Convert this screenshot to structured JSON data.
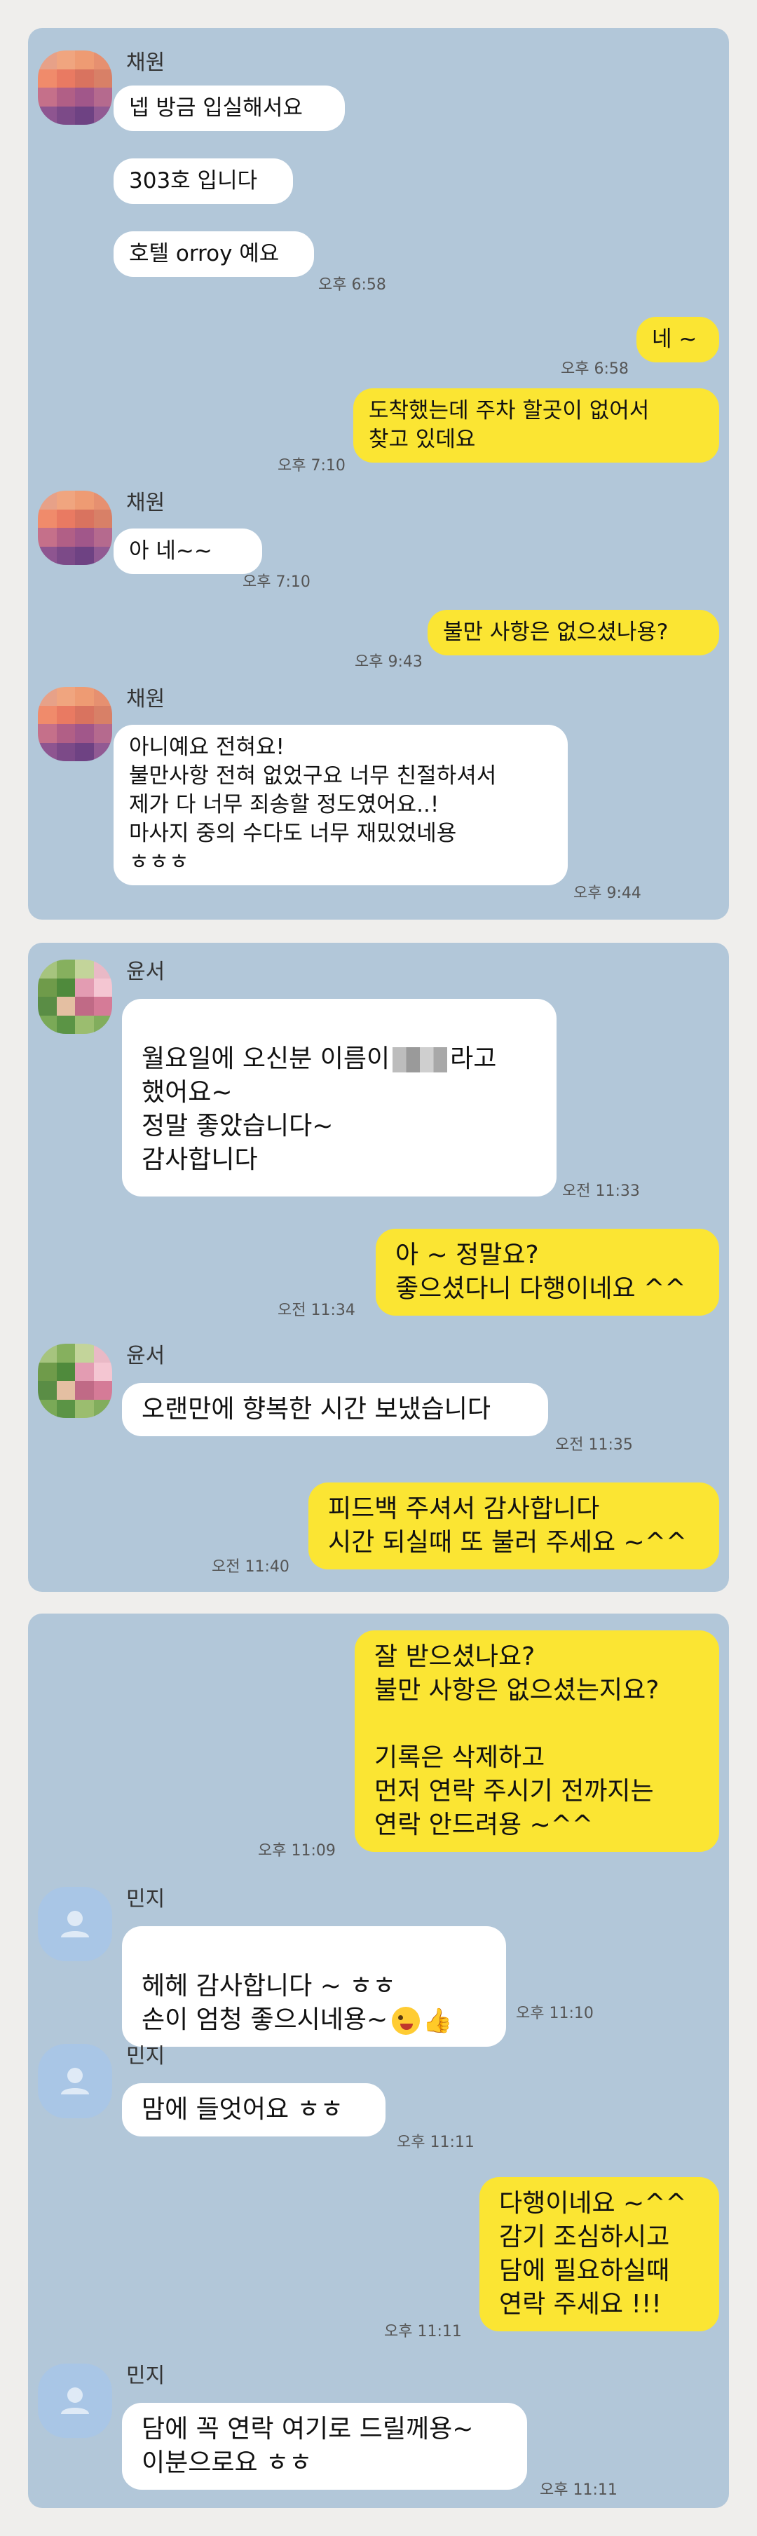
{
  "colors": {
    "chat_bg": "#b2c7d9",
    "page_bg": "#efeeec",
    "my_bubble": "#fbe533",
    "their_bubble": "#ffffff"
  },
  "panel1": {
    "sender_chaewon": "채원",
    "m1": "넵 방금 입실해서요",
    "m2": "303호 입니다",
    "m3": "호텔 orroy 예요",
    "t3": "오후 6:58",
    "m4": "네 ~",
    "t4": "오후 6:58",
    "m5": "도착했는데  주차 할곳이 없어서\n찾고 있데요",
    "t5": "오후 7:10",
    "m6": "아 네~~",
    "t6": "오후 7:10",
    "m7": "불만 사항은 없으셨나용?",
    "t7": "오후 9:43",
    "m8": "아니예요 전혀요!\n불만사항 전혀 없었구요 너무 친절하셔서\n제가 다 너무 죄송할 정도였어요..!\n마사지 중의 수다도 너무 재밌었네용\nㅎㅎㅎ",
    "t8": "오후 9:44"
  },
  "panel2": {
    "sender_yunseo": "윤서",
    "m1_a": "월요일에 오신분 이름이",
    "m1_b": "라고\n했어요~\n정말 좋았습니다~\n감사합니다",
    "t1": "오전 11:33",
    "m2": "아 ~ 정말요?\n좋으셨다니 다행이네요 ^^",
    "t2": "오전 11:34",
    "m3": "오랜만에 향복한 시간 보냈습니다",
    "t3": "오전 11:35",
    "m4": "피드백 주셔서 감사합니다\n시간 되실때 또 불러 주세요 ~^^",
    "t4": "오전 11:40"
  },
  "panel3": {
    "sender_minji": "민지",
    "m1": "잘 받으셨나요?\n불만 사항은 없으셨는지요?\n\n기록은 삭제하고\n먼저 연락 주시기 전까지는\n연락 안드려용 ~^^",
    "t1": "오후 11:09",
    "m2": "헤헤 감사합니다 ~ ㅎㅎ\n손이 엄청 좋으시네용~",
    "t2": "오후 11:10",
    "m3": "맘에 들엇어요 ㅎㅎ",
    "t3": "오후 11:11",
    "m4": "다행이네요 ~^^\n감기 조심하시고\n담에 필요하실때\n연락 주세요 !!!",
    "t4": "오후 11:11",
    "m5": "담에 꼭 연락 여기로 드릴께용~\n이분으로요 ㅎㅎ",
    "t5": "오후 11:11"
  }
}
